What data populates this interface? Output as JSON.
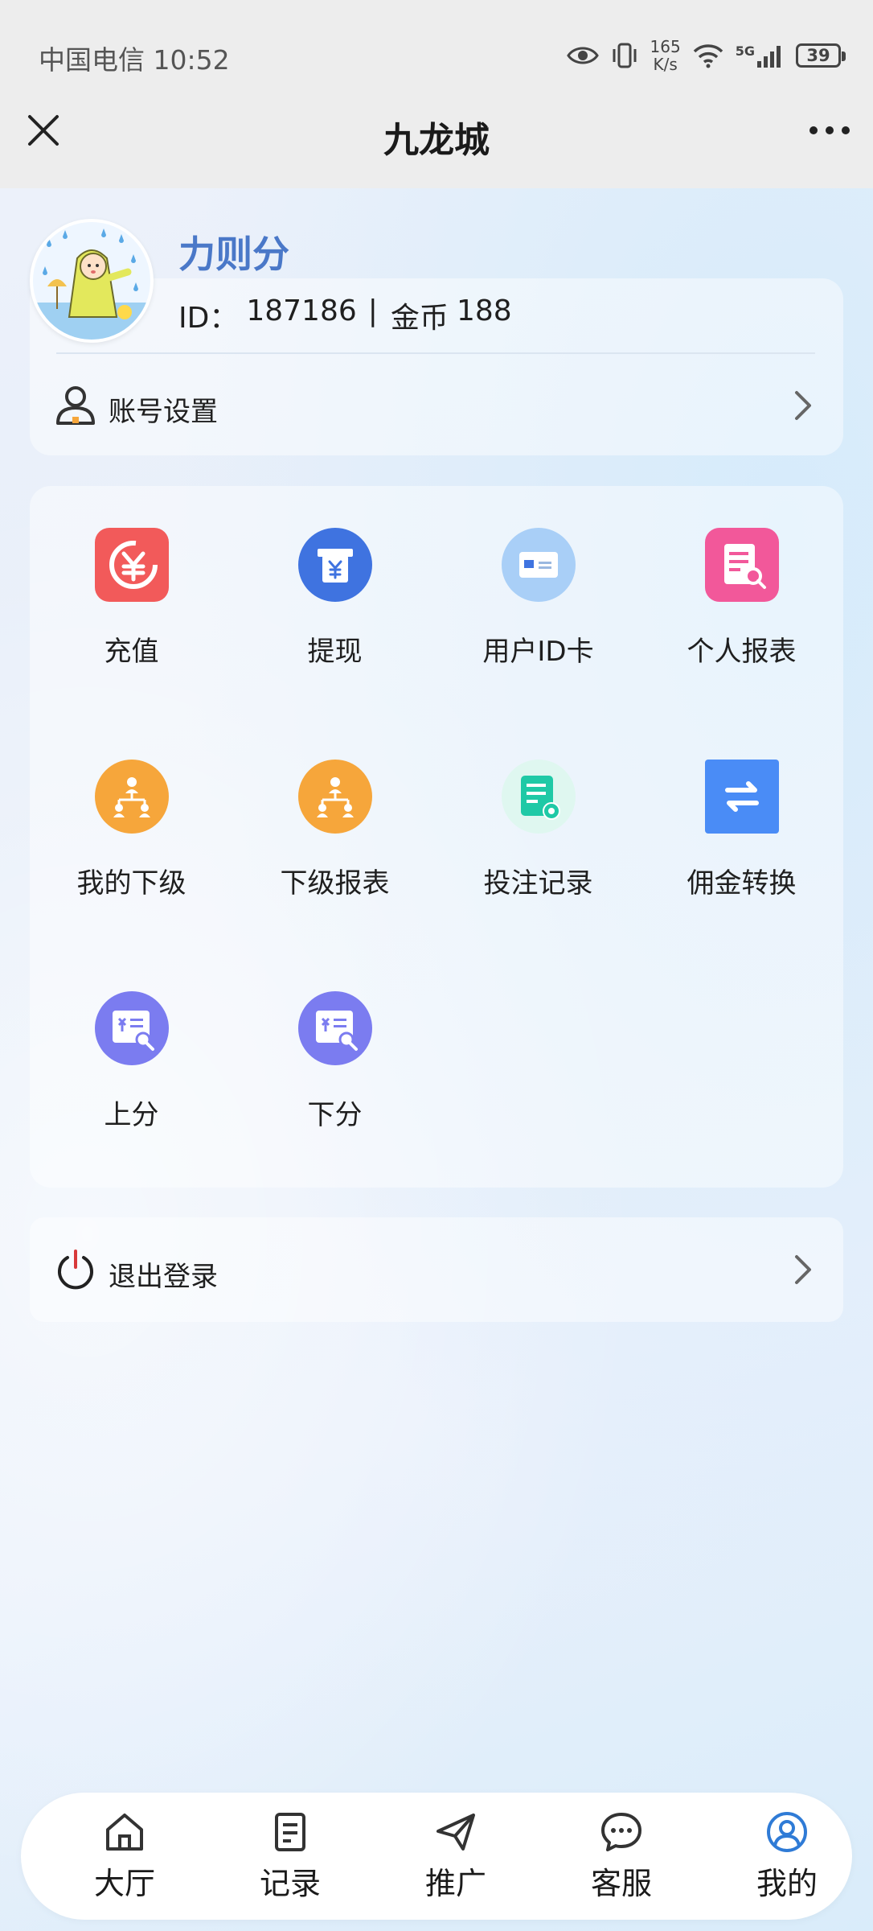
{
  "status_bar": {
    "carrier_time": "中国电信 10:52",
    "speed_value": "165",
    "speed_unit": "K/s",
    "network": "5G",
    "battery": "39",
    "icons": [
      "eye-icon",
      "vibrate-icon",
      "wifi-icon",
      "signal-icon",
      "battery-icon"
    ]
  },
  "header": {
    "title": "九龙城",
    "close_icon": "close-icon",
    "more_icon": "more-icon"
  },
  "profile": {
    "name": "力则分",
    "id_label": "ID：",
    "id_value": "187186",
    "separator": "|",
    "coin_label": "金币",
    "coin_value": "188",
    "settings_label": "账号设置"
  },
  "menu": {
    "items": [
      {
        "label": "充值",
        "icon": "recharge-icon",
        "color": "#f25a5a"
      },
      {
        "label": "提现",
        "icon": "withdraw-icon",
        "color": "#3f73e0"
      },
      {
        "label": "用户ID卡",
        "icon": "id-card-icon",
        "color": "#a9cff7"
      },
      {
        "label": "个人报表",
        "icon": "personal-report-icon",
        "color": "#f2589a"
      },
      {
        "label": "我的下级",
        "icon": "my-subordinates-icon",
        "color": "#f6a63b"
      },
      {
        "label": "下级报表",
        "icon": "subordinate-report-icon",
        "color": "#f6a63b"
      },
      {
        "label": "投注记录",
        "icon": "bet-record-icon",
        "color": "#1fc9a6"
      },
      {
        "label": "佣金转换",
        "icon": "commission-convert-icon",
        "color": "#4a8cf6"
      },
      {
        "label": "上分",
        "icon": "add-points-icon",
        "color": "#7b7cf0"
      },
      {
        "label": "下分",
        "icon": "remove-points-icon",
        "color": "#7b7cf0"
      }
    ]
  },
  "logout": {
    "label": "退出登录"
  },
  "bottom_nav": {
    "items": [
      {
        "label": "大厅",
        "icon": "home-icon"
      },
      {
        "label": "记录",
        "icon": "record-icon"
      },
      {
        "label": "推广",
        "icon": "send-icon"
      },
      {
        "label": "客服",
        "icon": "chat-icon"
      },
      {
        "label": "我的",
        "icon": "profile-icon",
        "active": true,
        "active_color": "#2f7bd6"
      }
    ]
  }
}
